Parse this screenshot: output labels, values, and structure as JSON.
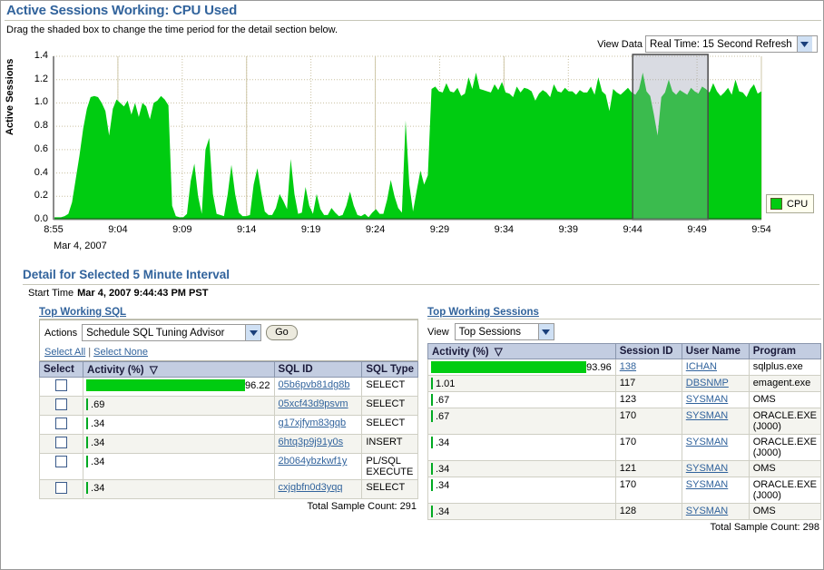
{
  "header": {
    "title": "Active Sessions Working: CPU Used",
    "instruction": "Drag the shaded box to change the time period for the detail section below.",
    "view_data_label": "View Data",
    "view_data_value": "Real Time: 15 Second Refresh"
  },
  "chart_data": {
    "type": "area",
    "title": "Active Sessions Working: CPU Used",
    "xlabel": "",
    "ylabel": "Active Sessions",
    "date_label": "Mar 4, 2007",
    "ylim": [
      0,
      1.4
    ],
    "yticks": [
      "0.0",
      "0.2",
      "0.4",
      "0.6",
      "0.8",
      "1.0",
      "1.2",
      "1.4"
    ],
    "xticks": [
      "8:55",
      "9:04",
      "9:09",
      "9:14",
      "9:19",
      "9:24",
      "9:29",
      "9:34",
      "9:39",
      "9:44",
      "9:49",
      "9:54"
    ],
    "grid": true,
    "legend": [
      {
        "name": "CPU",
        "color": "#00cc11"
      }
    ],
    "legend_position": "right",
    "series_color": "#00cc11",
    "selection": {
      "start": "9:44",
      "end": "9:49",
      "fill": "#d6d6e0"
    },
    "values": [
      0.02,
      0.02,
      0.02,
      0.03,
      0.05,
      0.15,
      0.35,
      0.55,
      0.78,
      0.95,
      1.05,
      1.06,
      1.05,
      1.0,
      0.93,
      0.72,
      0.95,
      1.03,
      1.0,
      0.97,
      1.02,
      0.9,
      1.0,
      0.88,
      1.0,
      0.97,
      0.86,
      1.0,
      1.02,
      1.06,
      1.03,
      0.98,
      0.12,
      0.03,
      0.02,
      0.02,
      0.05,
      0.33,
      0.48,
      0.2,
      0.05,
      0.6,
      0.7,
      0.22,
      0.05,
      0.04,
      0.03,
      0.22,
      0.47,
      0.22,
      0.06,
      0.03,
      0.03,
      0.04,
      0.3,
      0.44,
      0.24,
      0.07,
      0.04,
      0.04,
      0.1,
      0.22,
      0.16,
      0.09,
      0.52,
      0.22,
      0.05,
      0.06,
      0.28,
      0.12,
      0.05,
      0.22,
      0.09,
      0.04,
      0.04,
      0.1,
      0.06,
      0.03,
      0.04,
      0.12,
      0.24,
      0.12,
      0.04,
      0.03,
      0.05,
      0.02,
      0.06,
      0.09,
      0.05,
      0.05,
      0.17,
      0.34,
      0.2,
      0.1,
      0.06,
      0.85,
      0.3,
      0.07,
      0.25,
      0.42,
      0.3,
      0.38,
      1.12,
      1.14,
      1.1,
      1.09,
      1.17,
      1.1,
      1.09,
      1.13,
      1.06,
      1.08,
      1.22,
      1.12,
      1.26,
      1.12,
      1.11,
      1.1,
      1.09,
      1.16,
      1.11,
      1.18,
      1.09,
      1.08,
      1.05,
      1.14,
      1.09,
      1.13,
      1.12,
      1.1,
      1.02,
      1.08,
      1.11,
      1.09,
      1.05,
      1.16,
      1.1,
      1.09,
      1.13,
      1.1,
      1.1,
      1.07,
      1.11,
      1.09,
      1.09,
      1.14,
      1.07,
      1.22,
      1.1,
      1.07,
      0.93,
      1.12,
      1.09,
      1.07,
      1.1,
      1.13,
      1.09,
      1.07,
      1.12,
      1.26,
      1.1,
      1.06,
      0.9,
      0.72,
      1.05,
      1.09,
      1.2,
      1.1,
      1.07,
      1.11,
      1.09,
      1.07,
      1.13,
      1.1,
      1.08,
      1.14,
      1.12,
      1.09,
      1.17,
      1.1,
      1.06,
      1.09,
      1.13,
      1.07,
      1.2,
      1.1,
      1.09,
      1.05,
      1.12,
      1.16,
      1.08,
      1.1
    ]
  },
  "detail": {
    "title": "Detail for Selected 5 Minute Interval",
    "start_time_label": "Start Time",
    "start_time_value": "Mar 4, 2007 9:44:43 PM PST"
  },
  "top_sql": {
    "title": "Top Working SQL",
    "actions_label": "Actions",
    "actions_value": "Schedule SQL Tuning Advisor",
    "go_label": "Go",
    "select_all": "Select All",
    "select_none": "Select None",
    "columns": [
      "Select",
      "Activity (%)",
      "SQL ID",
      "SQL Type"
    ],
    "rows": [
      {
        "activity": "96.22",
        "bar_pct": 96.22,
        "sql_id": "05b6pvb81dg8b",
        "sql_type": "SELECT"
      },
      {
        "activity": ".69",
        "bar_pct": 0.69,
        "sql_id": "05xcf43d9psvm",
        "sql_type": "SELECT"
      },
      {
        "activity": ".34",
        "bar_pct": 0.34,
        "sql_id": "g17xjfym83gqb",
        "sql_type": "SELECT"
      },
      {
        "activity": ".34",
        "bar_pct": 0.34,
        "sql_id": "6htq3p9j91y0s",
        "sql_type": "INSERT"
      },
      {
        "activity": ".34",
        "bar_pct": 0.34,
        "sql_id": "2b064ybzkwf1y",
        "sql_type": "PL/SQL EXECUTE"
      },
      {
        "activity": ".34",
        "bar_pct": 0.34,
        "sql_id": "cxjqbfn0d3yqq",
        "sql_type": "SELECT"
      }
    ],
    "total": "Total Sample Count: 291"
  },
  "top_sessions": {
    "title": "Top Working Sessions",
    "view_label": "View",
    "view_value": "Top Sessions",
    "columns": [
      "Activity (%)",
      "Session ID",
      "User Name",
      "Program"
    ],
    "rows": [
      {
        "activity": "93.96",
        "bar_pct": 93.96,
        "session_id": "138",
        "user": "ICHAN",
        "program": "sqlplus.exe",
        "sid_link": true
      },
      {
        "activity": "1.01",
        "bar_pct": 1.01,
        "session_id": "117",
        "user": "DBSNMP",
        "program": "emagent.exe",
        "sid_link": false
      },
      {
        "activity": ".67",
        "bar_pct": 0.67,
        "session_id": "123",
        "user": "SYSMAN",
        "program": "OMS",
        "sid_link": false
      },
      {
        "activity": ".67",
        "bar_pct": 0.67,
        "session_id": "170",
        "user": "SYSMAN",
        "program": "ORACLE.EXE (J000)",
        "sid_link": false
      },
      {
        "activity": ".34",
        "bar_pct": 0.34,
        "session_id": "170",
        "user": "SYSMAN",
        "program": "ORACLE.EXE (J000)",
        "sid_link": false
      },
      {
        "activity": ".34",
        "bar_pct": 0.34,
        "session_id": "121",
        "user": "SYSMAN",
        "program": "OMS",
        "sid_link": false
      },
      {
        "activity": ".34",
        "bar_pct": 0.34,
        "session_id": "170",
        "user": "SYSMAN",
        "program": "ORACLE.EXE (J000)",
        "sid_link": false
      },
      {
        "activity": ".34",
        "bar_pct": 0.34,
        "session_id": "128",
        "user": "SYSMAN",
        "program": "OMS",
        "sid_link": false
      }
    ],
    "total": "Total Sample Count: 298"
  }
}
